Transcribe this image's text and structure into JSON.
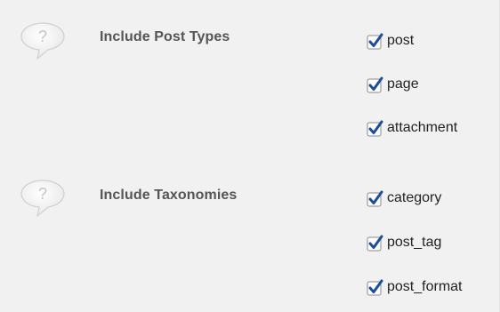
{
  "sections": [
    {
      "label": "Include Post Types",
      "help_icon": "question-speech-bubble-icon",
      "options": [
        {
          "label": "post",
          "checked": true
        },
        {
          "label": "page",
          "checked": true
        },
        {
          "label": "attachment",
          "checked": true
        }
      ]
    },
    {
      "label": "Include Taxonomies",
      "help_icon": "question-speech-bubble-icon",
      "options": [
        {
          "label": "category",
          "checked": true
        },
        {
          "label": "post_tag",
          "checked": true
        },
        {
          "label": "post_format",
          "checked": true
        }
      ]
    }
  ],
  "colors": {
    "background": "#f1f1f1",
    "label_text": "#555555",
    "option_text": "#222222",
    "checkmark": "#1d4e9a",
    "help_icon_fill": "#ffffff",
    "help_icon_glyph": "#c8c8c8"
  }
}
